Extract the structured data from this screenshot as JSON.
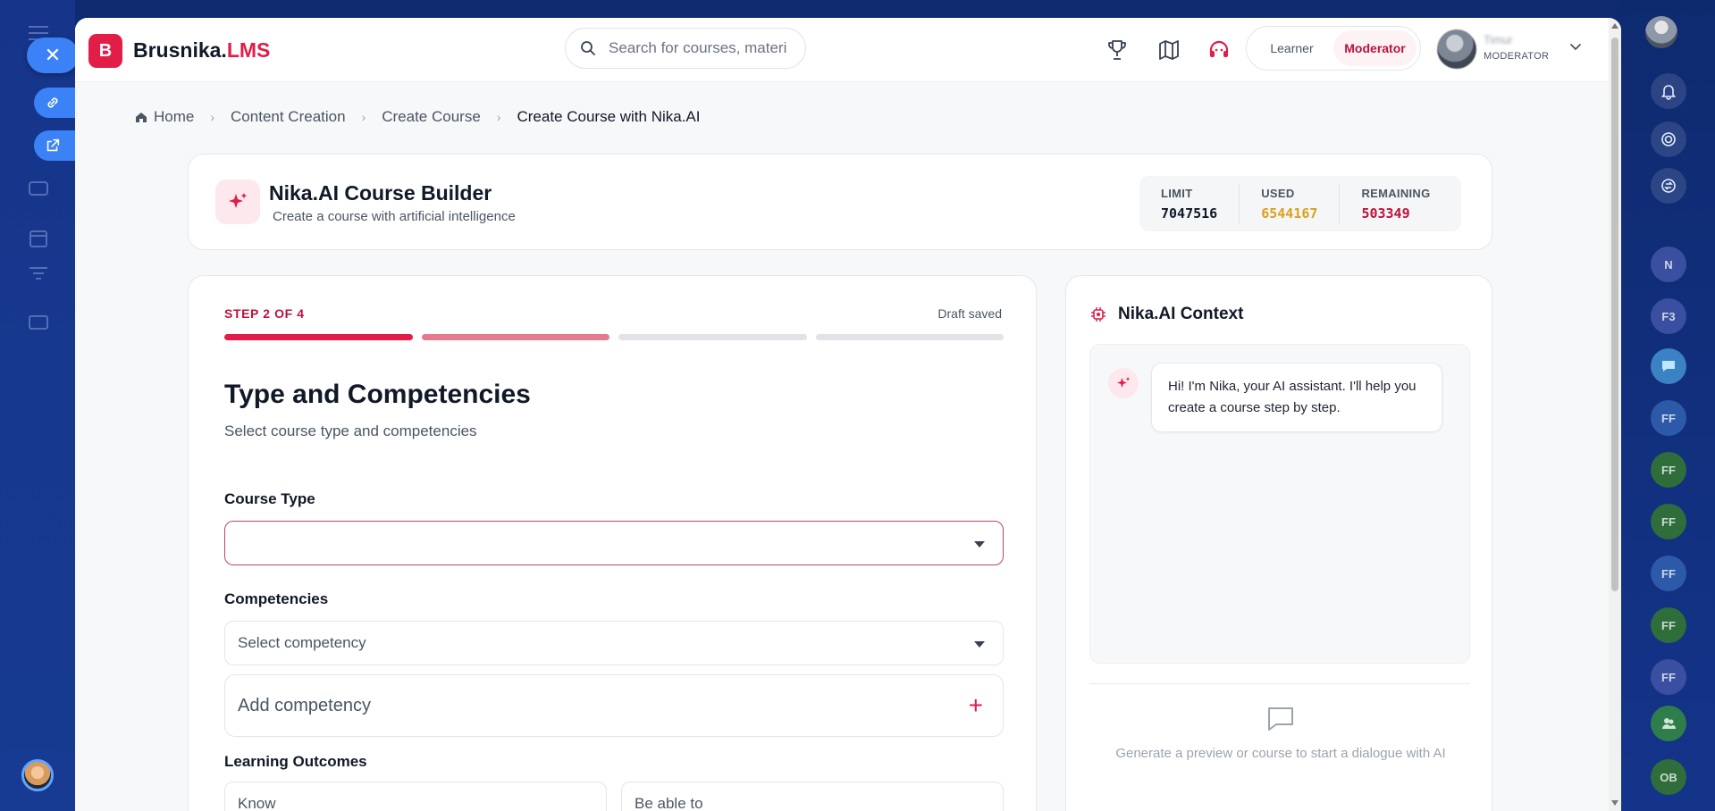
{
  "app": {
    "logo_letter": "B",
    "name_main": "Brusnika.",
    "name_accent": "LMS"
  },
  "search": {
    "placeholder": "Search for courses, materi"
  },
  "roles": {
    "learner": "Learner",
    "moderator": "Moderator",
    "active": "moderator"
  },
  "user": {
    "name": "Timur",
    "role": "MODERATOR"
  },
  "breadcrumb": {
    "home": "Home",
    "items": [
      "Content Creation",
      "Create Course"
    ],
    "current": "Create Course with Nika.AI"
  },
  "builder": {
    "title": "Nika.AI Course Builder",
    "subtitle": "Create a course with artificial intelligence",
    "stats": {
      "limit_label": "LIMIT",
      "limit_value": "7047516",
      "used_label": "USED",
      "used_value": "6544167",
      "remaining_label": "REMAINING",
      "remaining_value": "503349"
    }
  },
  "form": {
    "step_label": "STEP 2 OF 4",
    "draft_status": "Draft saved",
    "title": "Type and Competencies",
    "subtitle": "Select course type and competencies",
    "course_type_label": "Course Type",
    "course_type_value": "",
    "competencies_label": "Competencies",
    "competency_select_placeholder": "Select competency",
    "add_competency_placeholder": "Add competency",
    "add_icon": "+",
    "outcomes_label": "Learning Outcomes",
    "know_placeholder": "Know",
    "able_placeholder": "Be able to"
  },
  "context": {
    "title": "Nika.AI Context",
    "greeting": "Hi! I'm Nika, your AI assistant. I'll help you create a course step by step.",
    "hint": "Generate a preview or course to start a dialogue with AI"
  },
  "right_rail": {
    "chips": [
      "N",
      "F3",
      "FF",
      "FF",
      "FF",
      "FF",
      "FF",
      "FF",
      "OB"
    ]
  },
  "colors": {
    "brand": "#e11d48",
    "used": "#d9a21b",
    "remaining": "#be123c",
    "limit": "#111827"
  }
}
